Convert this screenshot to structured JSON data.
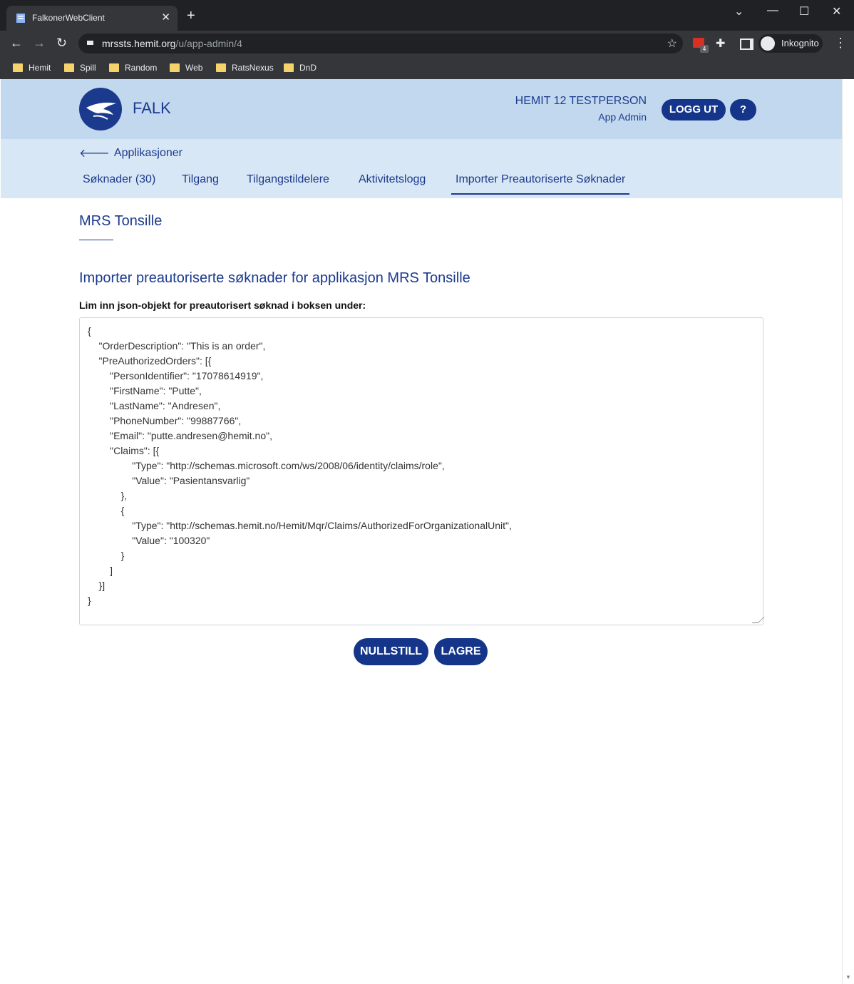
{
  "browser": {
    "tab_title": "FalkonerWebClient",
    "url_host": "mrssts.hemit.org",
    "url_path": "/u/app-admin/4",
    "extension_badge": "4",
    "incognito_label": "Inkognito",
    "bookmarks": [
      "Hemit",
      "Spill",
      "Random",
      "Web",
      "RatsNexus",
      "DnD"
    ]
  },
  "header": {
    "brand": "FALK",
    "user_name": "HEMIT 12 TESTPERSON",
    "user_role": "App Admin",
    "logout_label": "LOGG UT",
    "help_label": "?"
  },
  "subnav": {
    "back_label": "Applikasjoner",
    "tabs": [
      {
        "label": "Søknader (30)"
      },
      {
        "label": "Tilgang"
      },
      {
        "label": "Tilgangstildelere"
      },
      {
        "label": "Aktivitetslogg"
      },
      {
        "label": "Importer Preautoriserte Søknader",
        "active": true
      }
    ]
  },
  "main": {
    "app_title": "MRS Tonsille",
    "heading": "Importer preautoriserte søknader for applikasjon MRS Tonsille",
    "label": "Lim inn json-objekt for preautorisert søknad i boksen under:",
    "json": "{\n    \"OrderDescription\": \"This is an order\",\n    \"PreAuthorizedOrders\": [{\n        \"PersonIdentifier\": \"17078614919\",\n        \"FirstName\": \"Putte\",\n        \"LastName\": \"Andresen\",\n        \"PhoneNumber\": \"99887766\",\n        \"Email\": \"putte.andresen@hemit.no\",\n        \"Claims\": [{\n                \"Type\": \"http://schemas.microsoft.com/ws/2008/06/identity/claims/role\",\n                \"Value\": \"Pasientansvarlig\"\n            },\n            {\n                \"Type\": \"http://schemas.hemit.no/Hemit/Mqr/Claims/AuthorizedForOrganizationalUnit\",\n                \"Value\": \"100320\"\n            }\n        ]\n    }]\n}",
    "reset_label": "NULLSTILL",
    "save_label": "LAGRE"
  },
  "colors": {
    "primary": "#1b3a8e",
    "button": "#14358a",
    "header_bg": "#c2d8ee",
    "subnav_bg": "#d8e7f5"
  }
}
